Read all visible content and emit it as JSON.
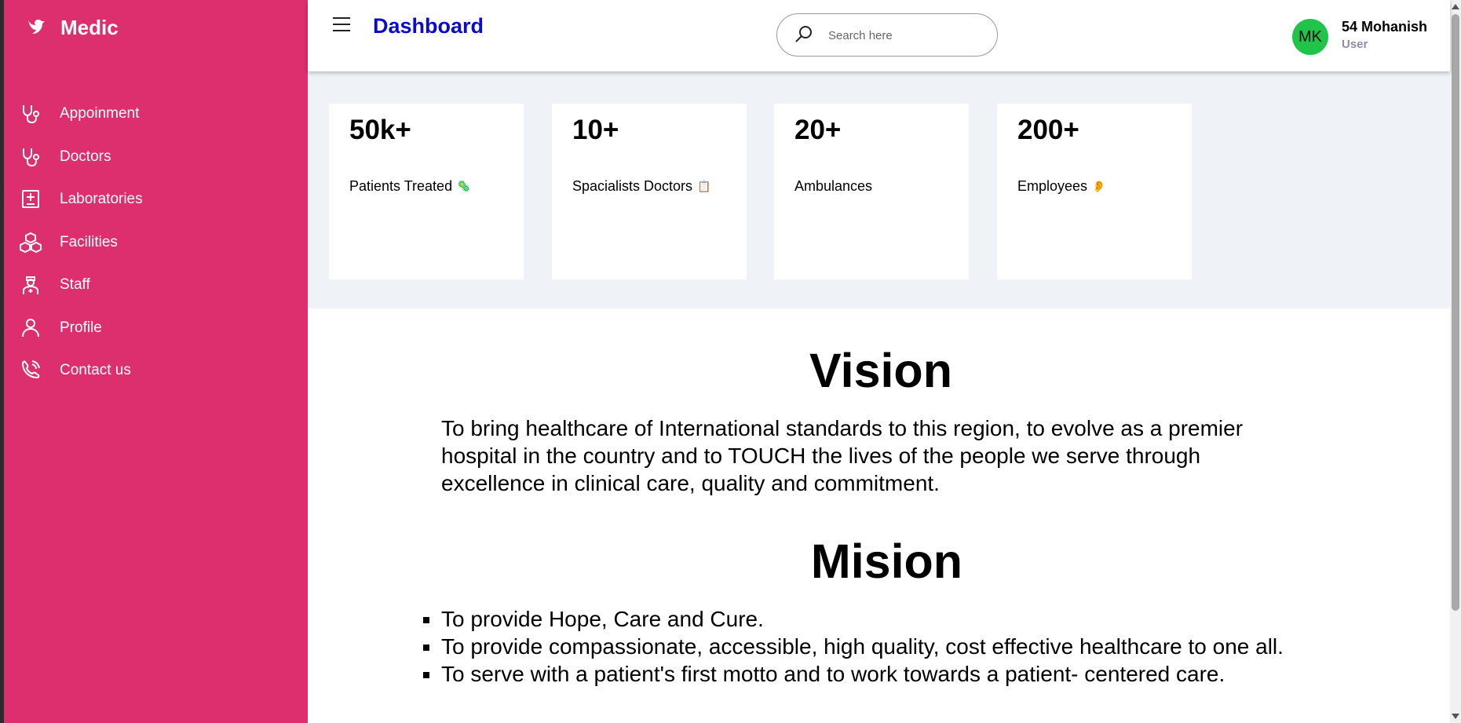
{
  "app": {
    "name": "Medic"
  },
  "sidebar": {
    "items": [
      {
        "label": "Appoinment",
        "icon": "stethoscope-icon"
      },
      {
        "label": "Doctors",
        "icon": "stethoscope-icon"
      },
      {
        "label": "Laboratories",
        "icon": "laboratory-icon"
      },
      {
        "label": "Facilities",
        "icon": "boxes-icon"
      },
      {
        "label": "Staff",
        "icon": "staff-icon"
      },
      {
        "label": "Profile",
        "icon": "user-icon"
      },
      {
        "label": "Contact us",
        "icon": "phone-icon"
      }
    ]
  },
  "header": {
    "title": "Dashboard",
    "search": {
      "placeholder": "Search here",
      "value": ""
    },
    "user": {
      "initials": "MK",
      "name": "54 Mohanish",
      "role": "User"
    }
  },
  "stats": [
    {
      "value": "50k+",
      "label": "Patients Treated",
      "emoji": "🦠"
    },
    {
      "value": "10+",
      "label": "Spacialists Doctors",
      "emoji": "📋"
    },
    {
      "value": "20+",
      "label": "Ambulances",
      "emoji": ""
    },
    {
      "value": "200+",
      "label": "Employees",
      "emoji": "👂"
    }
  ],
  "vision": {
    "heading": "Vision",
    "text": "To bring healthcare of International standards to this region, to evolve as a premier hospital in the country and to TOUCH the lives of the people we serve through excellence in clinical care, quality and commitment."
  },
  "mission": {
    "heading": "Mision",
    "items": [
      "To provide Hope, Care and Cure.",
      "To provide compassionate, accessible, high quality, cost effective healthcare to one all.",
      "To serve with a patient's first motto and to work towards a patient- centered care."
    ]
  },
  "colors": {
    "sidebar": "#dd2f6e",
    "title": "#0b0bd0",
    "avatar": "#1fc448",
    "stats_bg": "#eff3f7"
  }
}
